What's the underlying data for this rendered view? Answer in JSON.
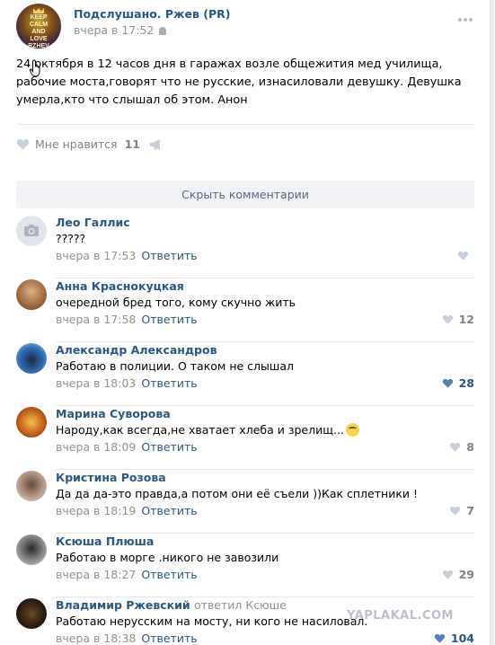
{
  "post": {
    "group_name": "Подслушано. Ржев (PR)",
    "time": "вчера в 17:52",
    "text": "24 октября в 12 часов дня в гаражах возле общежития мед училища, рабочие моста,говорят что не русские, изнасиловали девушку. Девушка умерла,кто что слышал об этом. Анон",
    "avatar_text": "KEEP CALM AND LOVE RZHEV",
    "like_label": "Мне нравится",
    "like_count": "11"
  },
  "hide_comments_label": "Скрыть комментарии",
  "reply_label": "Ответить",
  "comments": [
    {
      "author": "Лео Галлис",
      "text": "?????",
      "time": "вчера в 17:53",
      "likes": "",
      "liked": false,
      "avatar": "camera"
    },
    {
      "author": "Анна Краснокуцкая",
      "text": "очередной бред того, кому скучно жить",
      "time": "вчера в 17:58",
      "likes": "12",
      "liked": false,
      "avatar": "photo"
    },
    {
      "author": "Александр Александров",
      "text": "Работаю в полиции. О таком не слышал",
      "time": "вчера в 18:03",
      "likes": "28",
      "liked": true,
      "avatar": "photo"
    },
    {
      "author": "Марина Суворова",
      "text": "Народу,как всегда,не хватает хлеба и зрелищ...",
      "time": "вчера в 18:09",
      "likes": "8",
      "liked": false,
      "avatar": "photo"
    },
    {
      "author": "Кристина Розова",
      "text": "Да да да-это правда,а потом они её съели ))Как сплетники !",
      "time": "вчера в 18:19",
      "likes": "7",
      "liked": false,
      "avatar": "photo"
    },
    {
      "author": "Ксюша Плюша",
      "text": "Работаю в морге .никого не завозили",
      "time": "вчера в 18:27",
      "likes": "29",
      "liked": false,
      "avatar": "photo"
    },
    {
      "author": "Владимир Ржевский",
      "reply_to": "ответил Ксюше",
      "text": "Работаю нерусским на мосту, ни кого не насиловал.",
      "time": "вчера в 18:38",
      "likes": "104",
      "liked": true,
      "avatar": "photo"
    }
  ],
  "watermark": "YAPLAKAL.COM",
  "colors": {
    "link": "#2a5885",
    "muted": "#939393",
    "button_bg": "#f0f2f5",
    "divider": "#e7e8ec"
  }
}
